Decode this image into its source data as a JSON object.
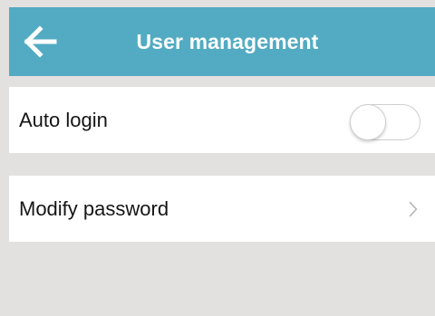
{
  "header": {
    "title": "User management",
    "back_icon": "arrow-left-icon",
    "background": "#52abc2"
  },
  "settings": {
    "auto_login": {
      "label": "Auto login",
      "toggle_on": false
    },
    "modify_password": {
      "label": "Modify password",
      "chevron_icon": "chevron-right-icon"
    }
  },
  "colors": {
    "page_background": "#e3e1df",
    "row_background": "#ffffff",
    "text": "#151515"
  }
}
